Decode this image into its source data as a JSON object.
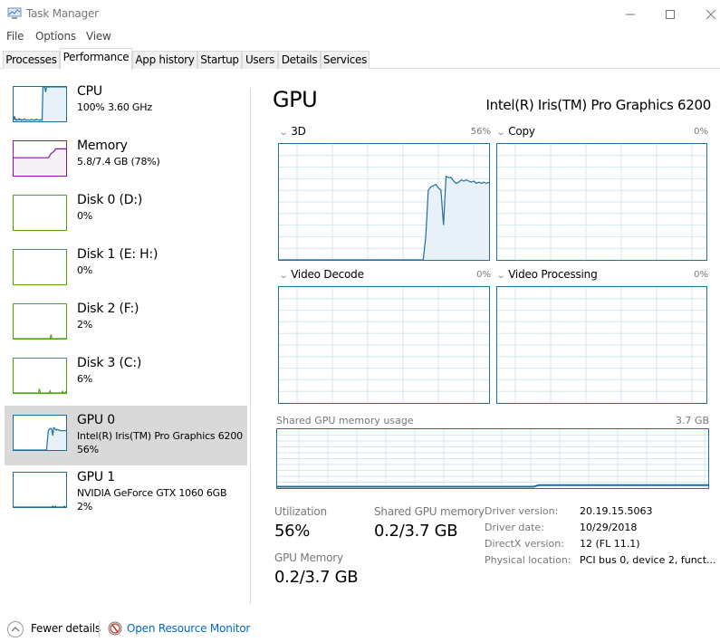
{
  "window": {
    "title": "Task Manager",
    "icon": "task-manager-icon",
    "controls": [
      "minimize-icon",
      "maximize-icon",
      "close-icon"
    ]
  },
  "menu": [
    "File",
    "Options",
    "View"
  ],
  "tabs": [
    {
      "label": "Processes",
      "active": false
    },
    {
      "label": "Performance",
      "active": true
    },
    {
      "label": "App history",
      "active": false
    },
    {
      "label": "Startup",
      "active": false
    },
    {
      "label": "Users",
      "active": false
    },
    {
      "label": "Details",
      "active": false
    },
    {
      "label": "Services",
      "active": false
    }
  ],
  "sidebar": [
    {
      "name": "CPU",
      "sub1": "100% 3.60 GHz",
      "sub2": "",
      "color": "#1f6f9e",
      "fill": "#e8f1f8",
      "history": [
        0.05,
        0.15,
        0.04,
        0.06,
        0.03,
        0.05,
        0.08,
        0.04,
        0.06,
        0.03,
        0.05,
        0.04,
        0.07,
        0.05,
        0.03,
        0.04,
        0.05,
        0.04,
        0.03,
        0.04,
        0.06,
        0.05,
        0.04,
        0.03,
        0.05,
        0.04,
        0.06,
        0.05,
        0.04,
        0.03,
        0.05,
        0.04,
        0.03,
        1.0,
        1.0,
        1.0,
        0.85,
        1.0,
        1.0,
        1.0,
        1.0,
        1.0,
        1.0,
        1.0,
        1.0,
        1.0,
        1.0,
        1.0,
        1.0,
        1.0,
        1.0,
        1.0,
        1.0,
        1.0,
        1.0,
        1.0,
        1.0,
        1.0,
        1.0,
        1.0
      ],
      "selected": false
    },
    {
      "name": "Memory",
      "sub1": "5.8/7.4 GB (78%)",
      "sub2": "",
      "color": "#8b12ae",
      "fill": "#f4f2f4",
      "history": [
        0.52,
        0.52,
        0.52,
        0.52,
        0.52,
        0.52,
        0.52,
        0.52,
        0.52,
        0.52,
        0.52,
        0.52,
        0.52,
        0.52,
        0.52,
        0.52,
        0.52,
        0.52,
        0.52,
        0.52,
        0.52,
        0.52,
        0.52,
        0.52,
        0.52,
        0.52,
        0.52,
        0.52,
        0.52,
        0.52,
        0.52,
        0.52,
        0.52,
        0.52,
        0.52,
        0.52,
        0.52,
        0.52,
        0.52,
        0.52,
        0.55,
        0.6,
        0.64,
        0.66,
        0.68,
        0.7,
        0.72,
        0.78,
        0.78,
        0.78,
        0.78,
        0.78,
        0.78,
        0.78,
        0.78,
        0.78,
        0.78,
        0.78,
        0.78,
        0.78
      ],
      "selected": false
    },
    {
      "name": "Disk 0 (D:)",
      "sub1": "0%",
      "sub2": "",
      "color": "#4da60c",
      "fill": "#eff7e9",
      "history": [],
      "selected": false
    },
    {
      "name": "Disk 1 (E: H:)",
      "sub1": "0%",
      "sub2": "",
      "color": "#4da60c",
      "fill": "#eff7e9",
      "history": [],
      "selected": false
    },
    {
      "name": "Disk 2 (F:)",
      "sub1": "2%",
      "sub2": "",
      "color": "#4da60c",
      "fill": "#eff7e9",
      "history": [
        0,
        0,
        0,
        0,
        0,
        0,
        0,
        0,
        0,
        0,
        0,
        0,
        0,
        0,
        0,
        0,
        0,
        0,
        0,
        0,
        0,
        0,
        0,
        0,
        0,
        0,
        0,
        0,
        0,
        0,
        0,
        0,
        0,
        0,
        0,
        0,
        0,
        0,
        0,
        0,
        0,
        0,
        0.12,
        0,
        0,
        0,
        0,
        0,
        0,
        0,
        0,
        0,
        0,
        0,
        0,
        0,
        0,
        0,
        0,
        0
      ],
      "selected": false
    },
    {
      "name": "Disk 3 (C:)",
      "sub1": "6%",
      "sub2": "",
      "color": "#4da60c",
      "fill": "#eff7e9",
      "history": [
        0,
        0,
        0,
        0,
        0,
        0,
        0,
        0,
        0,
        0,
        0,
        0,
        0,
        0,
        0,
        0,
        0,
        0,
        0,
        0,
        0,
        0,
        0,
        0,
        0,
        0,
        0,
        0,
        0,
        0.12,
        0,
        0,
        0,
        0,
        0,
        0,
        0,
        0,
        0,
        0,
        0,
        0.06,
        0,
        0,
        0,
        0,
        0,
        0,
        0,
        0,
        0,
        0,
        0,
        0,
        0,
        0.05,
        0,
        0,
        0,
        0.06
      ],
      "selected": false
    },
    {
      "name": "GPU 0",
      "sub1": "Intel(R) Iris(TM) Pro Graphics 6200",
      "sub2": "56%",
      "color": "#1f6f9e",
      "fill": "#e8f1f8",
      "history": [
        0,
        0,
        0,
        0,
        0,
        0,
        0,
        0,
        0,
        0,
        0,
        0,
        0,
        0,
        0,
        0,
        0,
        0,
        0,
        0,
        0,
        0,
        0,
        0,
        0,
        0,
        0,
        0,
        0,
        0,
        0,
        0,
        0,
        0,
        0,
        0,
        0,
        0.0,
        0.3,
        0.55,
        0.6,
        0.62,
        0.63,
        0.58,
        0.42,
        0.65,
        0.64,
        0.6,
        0.58,
        0.6,
        0.59,
        0.58,
        0.57,
        0.56,
        0.56,
        0.56,
        0.56,
        0.56,
        0.56,
        0.56
      ],
      "selected": true
    },
    {
      "name": "GPU 1",
      "sub1": "NVIDIA GeForce GTX 1060 6GB",
      "sub2": "2%",
      "color": "#1f6f9e",
      "fill": "#e8f1f8",
      "history": [
        0,
        0,
        0,
        0,
        0,
        0,
        0,
        0,
        0,
        0,
        0,
        0,
        0,
        0,
        0,
        0,
        0,
        0,
        0,
        0,
        0,
        0,
        0,
        0,
        0,
        0,
        0,
        0,
        0,
        0,
        0,
        0,
        0,
        0,
        0,
        0,
        0,
        0,
        0,
        0,
        0,
        0,
        0,
        0,
        0.03,
        0,
        0,
        0.03,
        0,
        0,
        0,
        0,
        0,
        0,
        0,
        0,
        0,
        0.03,
        0,
        0
      ],
      "selected": false
    }
  ],
  "main": {
    "title": "GPU",
    "model": "Intel(R) Iris(TM) Pro Graphics 6200",
    "engines": [
      {
        "label": "3D",
        "percent": "56%",
        "history": [
          0,
          0,
          0,
          0,
          0,
          0,
          0,
          0,
          0,
          0,
          0,
          0,
          0,
          0,
          0,
          0,
          0,
          0,
          0,
          0,
          0,
          0,
          0,
          0,
          0,
          0,
          0,
          0,
          0,
          0,
          0,
          0,
          0,
          0,
          0,
          0,
          0,
          0,
          0,
          0,
          0,
          0,
          0,
          0,
          0,
          0,
          0,
          0,
          0,
          0,
          0,
          0,
          0,
          0,
          0,
          0,
          0,
          0,
          0.2,
          0.6,
          0.63,
          0.64,
          0.65,
          0.62,
          0.6,
          0.3,
          0.72,
          0.71,
          0.71,
          0.68,
          0.66,
          0.67,
          0.69,
          0.68,
          0.69,
          0.68,
          0.67,
          0.68,
          0.66,
          0.67,
          0.66,
          0.67,
          0.66,
          0.67
        ]
      },
      {
        "label": "Copy",
        "percent": "0%",
        "history": []
      },
      {
        "label": "Video Decode",
        "percent": "0%",
        "history": []
      },
      {
        "label": "Video Processing",
        "percent": "0%",
        "history": []
      }
    ],
    "shared_memory": {
      "label": "Shared GPU memory usage",
      "max": "3.7 GB",
      "history_start": 0.0,
      "history_end": 0.05
    },
    "stats": {
      "utilization_label": "Utilization",
      "utilization_value": "56%",
      "shared_label": "Shared GPU memory",
      "shared_value": "0.2/3.7 GB",
      "gpu_memory_label": "GPU Memory",
      "gpu_memory_value": "0.2/3.7 GB"
    },
    "info": [
      {
        "label": "Driver version:",
        "value": "20.19.15.5063"
      },
      {
        "label": "Driver date:",
        "value": "10/29/2018"
      },
      {
        "label": "DirectX version:",
        "value": "12 (FL 11.1)"
      },
      {
        "label": "Physical location:",
        "value": "PCI bus 0, device 2, funct..."
      }
    ]
  },
  "footer": {
    "fewer_details": "Fewer details",
    "open_resource_monitor": "Open Resource Monitor"
  }
}
